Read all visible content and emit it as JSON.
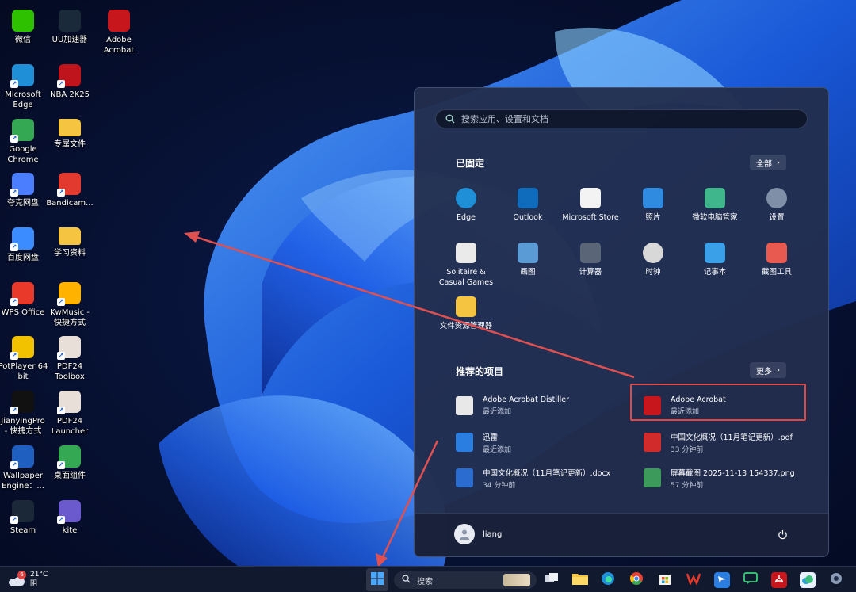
{
  "desktop": {
    "icons": [
      {
        "label": "微信",
        "icon": "wechat-icon",
        "color": "#2dc100"
      },
      {
        "label": "UU加速器",
        "icon": "uu-accelerator-icon",
        "color": "#1a2a3a"
      },
      {
        "label": "Adobe\nAcrobat",
        "icon": "adobe-acrobat-icon",
        "color": "#c8161d"
      },
      {
        "label": "Microsoft\nEdge",
        "icon": "edge-icon",
        "color": "#1f8fd8"
      },
      {
        "label": "NBA 2K25",
        "icon": "nba-2k25-icon",
        "color": "#c0141c"
      },
      {
        "label": "Google\nChrome",
        "icon": "chrome-icon",
        "color": "#34a853"
      },
      {
        "label": "专属文件",
        "icon": "folder-icon",
        "color": "#f5c542"
      },
      {
        "label": "夸克网盘",
        "icon": "quark-cloud-icon",
        "color": "#4a7dff"
      },
      {
        "label": "Bandicam...",
        "icon": "bandicam-icon",
        "color": "#e23a2e"
      },
      {
        "label": "百度网盘",
        "icon": "baidu-netdisk-icon",
        "color": "#3b8cff"
      },
      {
        "label": "学习资料",
        "icon": "folder-icon",
        "color": "#f5c542"
      },
      {
        "label": "WPS Office",
        "icon": "wps-office-icon",
        "color": "#e8392a"
      },
      {
        "label": "KwMusic -\n快捷方式",
        "icon": "kwmusic-icon",
        "color": "#ffb300"
      },
      {
        "label": "PotPlayer 64\nbit",
        "icon": "potplayer-icon",
        "color": "#f2c200"
      },
      {
        "label": "PDF24\nToolbox",
        "icon": "pdf24-toolbox-icon",
        "color": "#e8e0d8"
      },
      {
        "label": "JianyingPro\n- 快捷方式",
        "icon": "jianying-icon",
        "color": "#111111"
      },
      {
        "label": "PDF24\nLauncher",
        "icon": "pdf24-launcher-icon",
        "color": "#e8e0d8"
      },
      {
        "label": "Wallpaper\nEngine：...",
        "icon": "wallpaper-engine-icon",
        "color": "#1e5fbf"
      },
      {
        "label": "桌面组件",
        "icon": "desktop-widgets-icon",
        "color": "#34a853"
      },
      {
        "label": "Steam",
        "icon": "steam-icon",
        "color": "#1b2838"
      },
      {
        "label": "kite",
        "icon": "kite-icon",
        "color": "#6a5acd"
      }
    ]
  },
  "start_menu": {
    "search_placeholder": "搜索应用、设置和文档",
    "pinned_title": "已固定",
    "all_label": "全部",
    "pinned": [
      {
        "label": "Edge",
        "icon": "edge-icon",
        "color": "#1f8fd8"
      },
      {
        "label": "Outlook",
        "icon": "outlook-icon",
        "color": "#0f6cbd"
      },
      {
        "label": "Microsoft Store",
        "icon": "microsoft-store-icon",
        "color": "#f3f3f3"
      },
      {
        "label": "照片",
        "icon": "photos-icon",
        "color": "#2e8be0"
      },
      {
        "label": "微软电脑管家",
        "icon": "pc-manager-icon",
        "color": "#3fb68b"
      },
      {
        "label": "设置",
        "icon": "settings-icon",
        "color": "#7f8fa8"
      },
      {
        "label": "Solitaire &\nCasual Games",
        "icon": "solitaire-icon",
        "color": "#eaeaea"
      },
      {
        "label": "画图",
        "icon": "paint-icon",
        "color": "#5b9bd5"
      },
      {
        "label": "计算器",
        "icon": "calculator-icon",
        "color": "#5a6578"
      },
      {
        "label": "时钟",
        "icon": "clock-icon",
        "color": "#d8d8d8"
      },
      {
        "label": "记事本",
        "icon": "notepad-icon",
        "color": "#3aa0e8"
      },
      {
        "label": "截图工具",
        "icon": "snipping-tool-icon",
        "color": "#e85a4f"
      },
      {
        "label": "文件资源管理器",
        "icon": "file-explorer-icon",
        "color": "#f5c542"
      }
    ],
    "recommended_title": "推荐的项目",
    "more_label": "更多",
    "recommended": [
      {
        "name": "Adobe Acrobat Distiller",
        "sub": "最近添加",
        "icon": "acrobat-distiller-icon",
        "color": "#e8e8e8"
      },
      {
        "name": "Adobe Acrobat",
        "sub": "最近添加",
        "icon": "adobe-acrobat-icon",
        "color": "#c8161d"
      },
      {
        "name": "迅雷",
        "sub": "最近添加",
        "icon": "xunlei-icon",
        "color": "#2a7de1"
      },
      {
        "name": "中国文化概况（11月笔记更新）.pdf",
        "sub": "33 分钟前",
        "icon": "pdf-file-icon",
        "color": "#d12b2b"
      },
      {
        "name": "中国文化概况（11月笔记更新）.docx",
        "sub": "34 分钟前",
        "icon": "word-file-icon",
        "color": "#2b6cd1"
      },
      {
        "name": "屏幕截图 2025-11-13 154337.png",
        "sub": "57 分钟前",
        "icon": "png-file-icon",
        "color": "#3c9a5a"
      }
    ],
    "user_name": "liang"
  },
  "taskbar": {
    "weather_temp": "21°C",
    "weather_cond": "阴",
    "weather_badge": "6",
    "search_label": "搜索"
  },
  "colors": {
    "accent": "#2a6de0",
    "highlight": "#e04848"
  }
}
